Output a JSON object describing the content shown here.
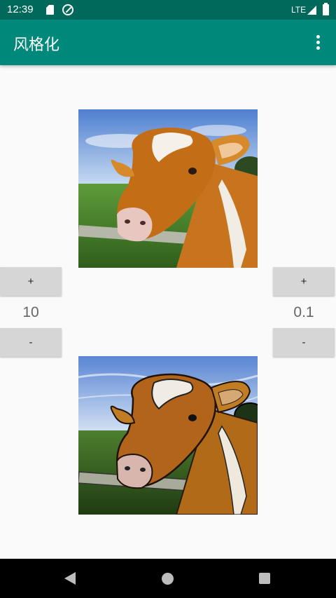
{
  "status_bar": {
    "time": "12:39",
    "network": "LTE",
    "icons": [
      "sd-card-icon",
      "sync-icon",
      "signal-icon",
      "battery-icon"
    ]
  },
  "app_bar": {
    "title": "风格化",
    "menu_icon": "more-vert-icon"
  },
  "images": {
    "original": "cow-photo",
    "stylized": "cow-stylized"
  },
  "left_control": {
    "plus_label": "+",
    "value": "10",
    "minus_label": "-"
  },
  "right_control": {
    "plus_label": "+",
    "value": "0.1",
    "minus_label": "-"
  },
  "nav_bar": {
    "icons": [
      "back-icon",
      "home-icon",
      "recents-icon"
    ]
  },
  "colors": {
    "status_bar": "#00695c",
    "app_bar": "#00897b",
    "button": "#d6d6d6",
    "background": "#fafafa"
  }
}
